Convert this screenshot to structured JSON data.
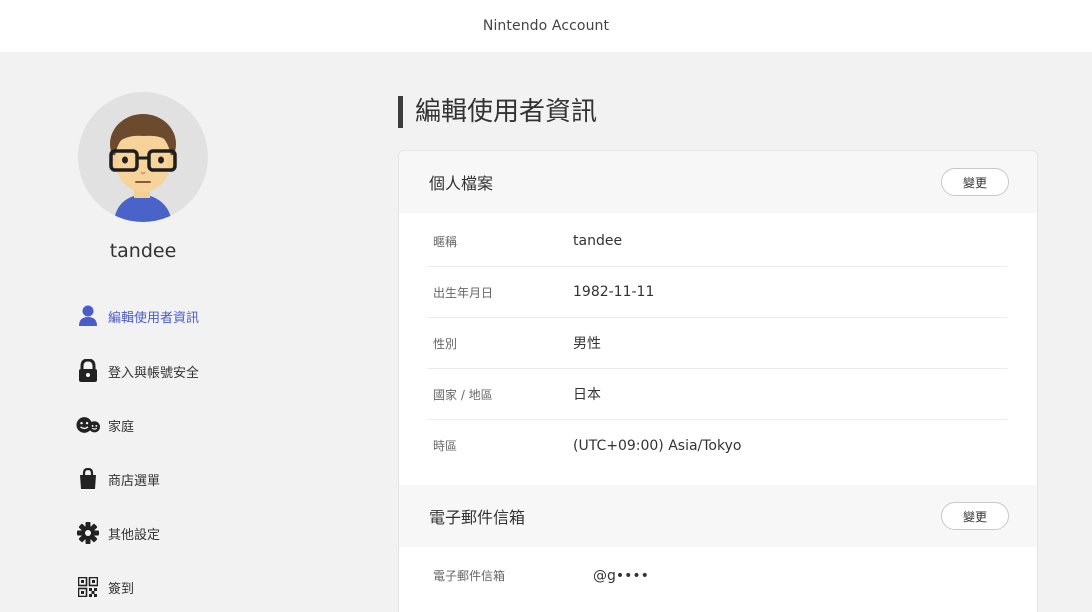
{
  "header": {
    "title": "Nintendo Account"
  },
  "profile": {
    "username": "tandee"
  },
  "sidebar": {
    "items": [
      {
        "label": "編輯使用者資訊",
        "icon": "person-icon",
        "active": true
      },
      {
        "label": "登入與帳號安全",
        "icon": "lock-icon"
      },
      {
        "label": "家庭",
        "icon": "family-icon"
      },
      {
        "label": "商店選單",
        "icon": "shopping-bag-icon"
      },
      {
        "label": "其他設定",
        "icon": "gear-icon"
      },
      {
        "label": "簽到",
        "icon": "qr-code-icon"
      }
    ]
  },
  "main": {
    "title": "編輯使用者資訊",
    "profile_section": {
      "title": "個人檔案",
      "change_label": "變更",
      "rows": [
        {
          "label": "暱稱",
          "value": "tandee"
        },
        {
          "label": "出生年月日",
          "value": "1982-11-11"
        },
        {
          "label": "性別",
          "value": "男性"
        },
        {
          "label": "國家 / 地區",
          "value": "日本"
        },
        {
          "label": "時區",
          "value": "(UTC+09:00) Asia/Tokyo"
        }
      ]
    },
    "email_section": {
      "title": "電子郵件信箱",
      "change_label": "變更",
      "rows": [
        {
          "label": "電子郵件信箱",
          "value": "@g••••"
        }
      ]
    }
  },
  "colors": {
    "accent": "#4a5cc8",
    "background": "#f2f2f2",
    "card": "#ffffff"
  }
}
